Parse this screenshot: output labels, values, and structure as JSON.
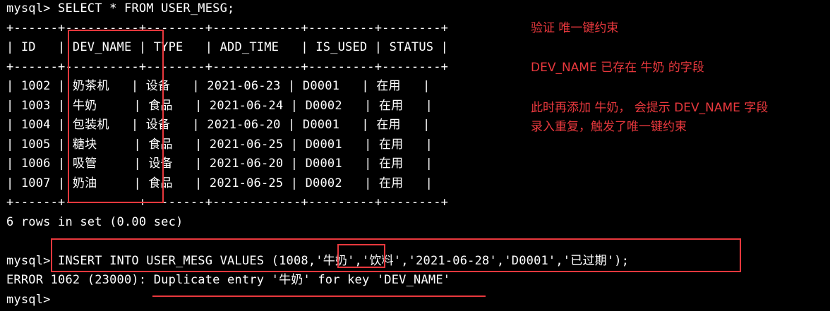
{
  "terminal": {
    "lines": [
      "mysql> SELECT * FROM USER_MESG;",
      "+------+----------+--------+------------+---------+--------+",
      "| ID   | DEV_NAME | TYPE   | ADD_TIME   | IS_USED | STATUS |",
      "+------+----------+--------+------------+---------+--------+",
      "| 1002 | 奶茶机   | 设备   | 2021-06-23 | D0001   | 在用   |",
      "| 1003 | 牛奶     | 食品   | 2021-06-24 | D0002   | 在用   |",
      "| 1004 | 包装机   | 设备   | 2021-06-20 | D0001   | 在用   |",
      "| 1005 | 糖块     | 食品   | 2021-06-25 | D0001   | 在用   |",
      "| 1006 | 吸管     | 设备   | 2021-06-20 | D0001   | 在用   |",
      "| 1007 | 奶油     | 食品   | 2021-06-25 | D0002   | 在用   |",
      "+------+----------+--------+------------+---------+--------+",
      "6 rows in set (0.00 sec)",
      "",
      "mysql> INSERT INTO USER_MESG VALUES (1008,'牛奶','饮料','2021-06-28','D0001','已过期');",
      "ERROR 1062 (23000): Duplicate entry '牛奶' for key 'DEV_NAME'",
      "mysql>"
    ]
  },
  "annotations": {
    "line1": "验证 唯一键约束",
    "line2": "DEV_NAME 已存在 牛奶 的字段",
    "line3": "此时再添加 牛奶， 会提示 DEV_NAME 字段",
    "line4": "录入重复，触发了唯一键约束"
  },
  "colors": {
    "background": "#000000",
    "text": "#ffffff",
    "annotation": "#e8383d"
  }
}
